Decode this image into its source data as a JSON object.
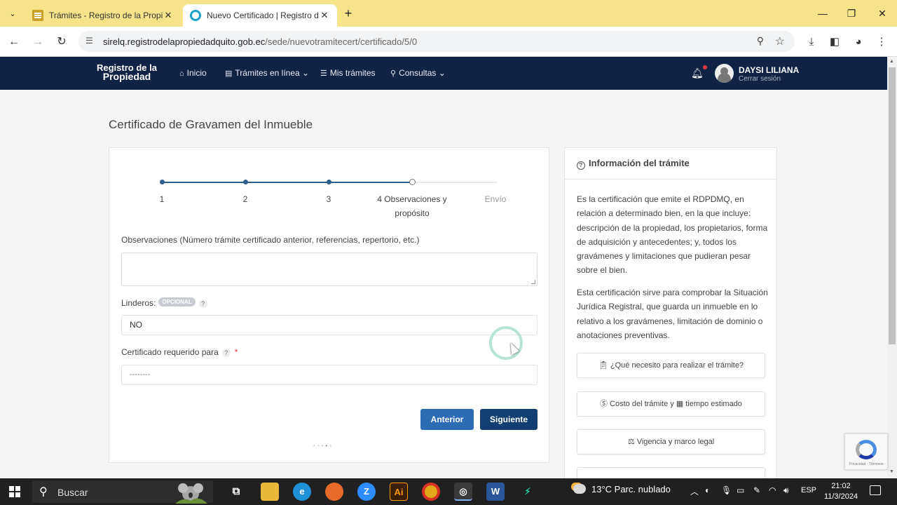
{
  "browser": {
    "tabs": [
      {
        "title": "Trámites - Registro de la Propie",
        "active": false
      },
      {
        "title": "Nuevo Certificado | Registro de",
        "active": true
      }
    ],
    "url_host": "sirelq.registrodelapropiedadquito.gob.ec",
    "url_path": "/sede/nuevotramitecert/certificado/5/0",
    "tab_bar_color": "#f7e38a"
  },
  "site": {
    "logo_line1": "Registro de la",
    "logo_line2": "Propiedad",
    "nav": [
      {
        "label": "Inicio",
        "icon": "home-icon"
      },
      {
        "label": "Trámites en línea",
        "icon": "document-icon",
        "dropdown": true
      },
      {
        "label": "Mis trámites",
        "icon": "list-icon"
      },
      {
        "label": "Consultas",
        "icon": "search-icon",
        "dropdown": true
      }
    ],
    "user_name": "DAYSI LILIANA",
    "logout_label": "Cerrar sesión",
    "header_color": "#0f2345"
  },
  "page": {
    "title": "Certificado de Gravamen del Inmueble",
    "steps": [
      {
        "label": "1",
        "state": "done"
      },
      {
        "label": "2",
        "state": "done"
      },
      {
        "label": "3",
        "state": "done"
      },
      {
        "label": "4 Observaciones y propósito",
        "state": "current"
      },
      {
        "label": "Envío",
        "state": "todo"
      }
    ],
    "observaciones_label": "Observaciones (Número trámite certificado anterior, referencias, repertorio, etc.)",
    "observaciones_value": "",
    "linderos_label": "Linderos:",
    "optional_badge": "OPCIONAL",
    "help_mark": "?",
    "linderos_value": "NO",
    "certificado_label": "Certificado requerido para",
    "required_mark": "*",
    "certificado_value": "--------",
    "btn_prev": "Anterior",
    "btn_next": "Siguiente"
  },
  "info": {
    "title": "Información del trámite",
    "paragraph1": "Es la certificación que emite el RDPDMQ, en relación a determinado bien, en la que incluye: descripción de la propiedad, los propietarios, forma de adquisición y antecedentes; y, todos los gravámenes y limitaciones que pudieran pesar sobre el bien.",
    "paragraph2": "Esta certificación sirve para comprobar la Situación Jurídica Registral, que guarda un inmueble en lo relativo a los gravámenes, limitación de dominio o anotaciones preventivas.",
    "btn_requirements": "¿Qué necesito para realizar el trámite?",
    "btn_cost_a": "Costo del trámite y",
    "btn_cost_b": "tiempo estimado",
    "btn_legal": "Vigencia y marco legal"
  },
  "recaptcha": {
    "footer": "Privacidad - Términos"
  },
  "taskbar": {
    "search_placeholder": "Buscar",
    "weather": "13°C  Parc. nublado",
    "language": "ESP",
    "time": "21:02",
    "date": "11/3/2024"
  }
}
